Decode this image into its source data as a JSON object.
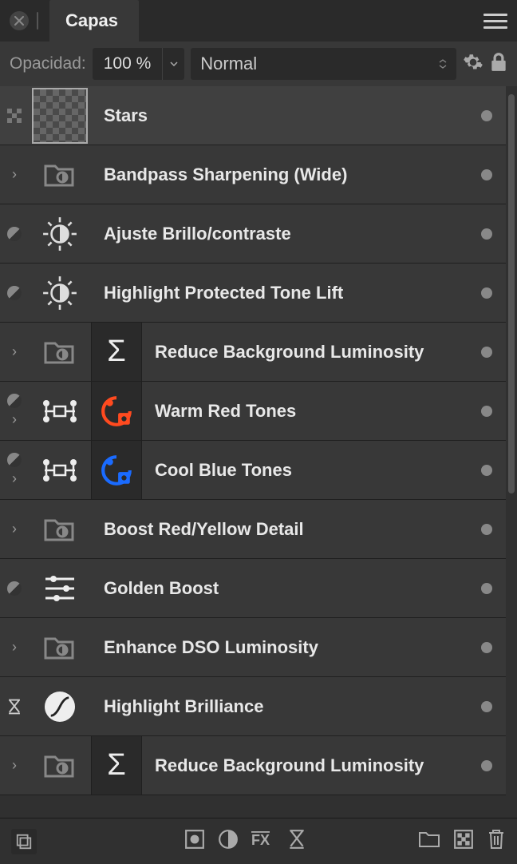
{
  "header": {
    "tab_title": "Capas"
  },
  "toolbar": {
    "opacity_label": "Opacidad:",
    "opacity_value": "100 %",
    "blend_mode": "Normal"
  },
  "layers": [
    {
      "name": "Stars",
      "left": "checker",
      "thumb": "checker",
      "extra": null,
      "selected": true
    },
    {
      "name": "Bandpass Sharpening (Wide)",
      "left": "disclosure",
      "thumb": "group",
      "extra": null,
      "selected": false
    },
    {
      "name": "Ajuste Brillo/contraste",
      "left": "adj",
      "thumb": "brightsun",
      "extra": null,
      "selected": false
    },
    {
      "name": "Highlight Protected Tone Lift",
      "left": "adj",
      "thumb": "brightsun",
      "extra": null,
      "selected": false
    },
    {
      "name": "Reduce Background Luminosity",
      "left": "disclosure",
      "thumb": "group",
      "extra": "sigma",
      "selected": false
    },
    {
      "name": "Warm Red Tones",
      "left": "adj+disc",
      "thumb": "nodes",
      "extra": "swirl-red",
      "selected": false
    },
    {
      "name": "Cool Blue Tones",
      "left": "adj+disc",
      "thumb": "nodes",
      "extra": "swirl-blue",
      "selected": false
    },
    {
      "name": "Boost Red/Yellow Detail",
      "left": "disclosure",
      "thumb": "group",
      "extra": null,
      "selected": false
    },
    {
      "name": "Golden Boost",
      "left": "adj",
      "thumb": "sliders",
      "extra": null,
      "selected": false
    },
    {
      "name": "Enhance DSO Luminosity",
      "left": "disclosure",
      "thumb": "group",
      "extra": null,
      "selected": false
    },
    {
      "name": "Highlight Brilliance",
      "left": "hourglass",
      "thumb": "curvecircle",
      "extra": null,
      "selected": false
    },
    {
      "name": "Reduce Background Luminosity",
      "left": "disclosure",
      "thumb": "group",
      "extra": "sigma",
      "selected": false
    }
  ]
}
